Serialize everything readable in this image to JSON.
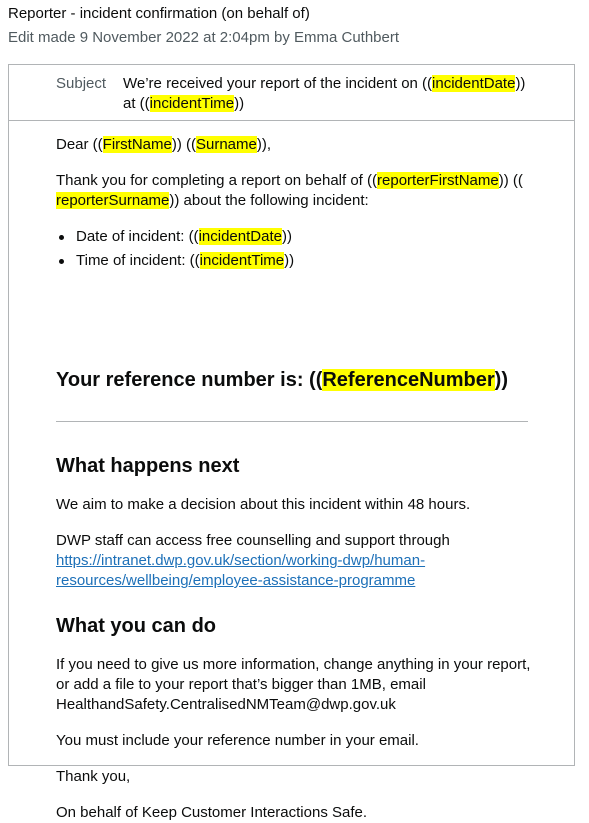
{
  "header": {
    "title": "Reporter - incident confirmation (on behalf of)",
    "edit_info": "Edit made 9 November 2022 at 2:04pm by Emma Cuthbert"
  },
  "subject": {
    "label": "Subject",
    "pre": "We’re received your report of the incident on ((",
    "var1": "incidentDate",
    "mid": "))",
    "line2_pre": "at ((",
    "var2": "incidentTime",
    "line2_post": "))"
  },
  "body": {
    "dear": {
      "pre": "Dear ((",
      "v1": "FirstName",
      "mid": ")) ((",
      "v2": "Surname",
      "post": ")),"
    },
    "thanks": {
      "pre": "Thank you for completing a report on behalf of ((",
      "v1": "reporterFirstName",
      "mid": ")) ((",
      "v2": "reporterSurname",
      "post": ")) about the following incident:"
    },
    "bullets": [
      {
        "pre": "Date of incident: ((",
        "var": "incidentDate",
        "post": "))"
      },
      {
        "pre": "Time of incident: ((",
        "var": "incidentTime",
        "post": "))"
      }
    ],
    "reference": {
      "pre": "Your reference number is: ((",
      "var": "ReferenceNumber",
      "post": "))"
    },
    "next_heading": "What happens next",
    "aim_text": "We aim to make a decision about this incident within 48 hours.",
    "dwp_text": "DWP staff can access free counselling and support through",
    "dwp_link": "https://intranet.dwp.gov.uk/section/working-dwp/human-resources/wellbeing/employee-assistance-programme",
    "cando_heading": "What you can do",
    "ifneed_text": "If you need to give us more information, change anything in your report, or add a file to your report that’s bigger than 1MB, email HealthandSafety.CentralisedNMTeam@dwp.gov.uk",
    "must_text": "You must include your reference number in your email.",
    "thankyou_text": "Thank you,",
    "onbehalf_text": "On behalf of Keep Customer Interactions Safe."
  },
  "colors": {
    "highlight": "#ffff00",
    "link": "#1d70b8",
    "border": "#b1b4b6",
    "secondary_text": "#505a5f"
  }
}
